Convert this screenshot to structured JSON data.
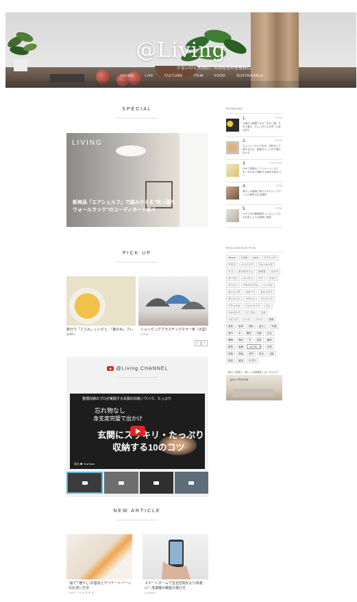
{
  "site": {
    "logo": "@Living",
    "tagline": "少ないけど大切に、大切なものを毎日に。",
    "nav": [
      "LIVING",
      "LIFE",
      "CULTURE",
      "ITEM",
      "FOOD",
      "SUSTAINABLE"
    ]
  },
  "special": {
    "heading": "SPECIAL",
    "feature": {
      "label": "LIVING",
      "caption": "新商品「エアシェルフ」で組みかえる“突っ張りウォールラック”のコーディネート術６"
    }
  },
  "pickup": {
    "heading": "PICK UP",
    "cards": [
      {
        "text": "数分で「ささみ」レシピと、「春の水」ブレンド",
        "tag": "FOOD"
      },
      {
        "text": "ショッピングプラスチックカラー傘（大型）",
        "tag": "ITEM"
      }
    ],
    "prev": "‹",
    "next": "›"
  },
  "channel": {
    "heading": "@Living CHANNEL",
    "video": {
      "title": "整理収納のプロが実践する玄関の収納ノウハウ、たっぷり",
      "line1": "忘れ物なし",
      "line2": "身支度完璧で出かけ",
      "big1": "玄関にスッキリ・たっぷり",
      "big2": "収納する10のコツ",
      "watch": "見る ▶ YouTube"
    }
  },
  "new_article": {
    "heading": "NEW ARTICLE",
    "cards": [
      {
        "text": "“捨て”“増やし”の基本とデリケートゾーンのお洗い方法",
        "tag": "LIFE・ヘルスケア"
      },
      {
        "text": "スマートホームで生活空間がより快適に！洗濯機の機能の選び方",
        "tag": "LIVING"
      }
    ]
  },
  "sidebar": {
    "ranking_heading": "RANKING",
    "ranking": [
      {
        "num": "1.",
        "cat": "FOOD",
        "text": "冷凍から調理できる「まぜご飯」を作り置き、忙しい日でも手早くお弁当作り"
      },
      {
        "num": "2.",
        "cat": "FOOD",
        "text": "ホムフォーカルで作る！材料なしで漬けるだけ、簡単おいしい作り置きおかず"
      },
      {
        "num": "3.",
        "cat": "CULTURE",
        "text": "SNSで話題の「パッケージ」の工夫！iPhoneで撮影する猫の写真のコツ"
      },
      {
        "num": "4.",
        "cat": "ITEM",
        "text": "暮らしの道具に取り入れたい！ナチュラル素材の生活雑貨"
      },
      {
        "num": "5.",
        "cat": "ITEM",
        "text": "やすらぎの朝時間をつくるシンプルなお気に入りの家具と雑貨"
      }
    ],
    "tags_heading": "Recommend TAG",
    "tags": [
      "iPhone",
      "100均",
      "IKEA",
      "アウトドア",
      "アロマ",
      "インテリア",
      "ウォーキング",
      "エコ",
      "おうちカフェ",
      "お弁当",
      "カメラ",
      "ガーデン",
      "キッチン",
      "ケア",
      "コスメ",
      "コーヒー",
      "サステナブル",
      "シンプル",
      "ストレッチ",
      "スポーツ",
      "セルフケア",
      "ダイエット",
      "デザイン",
      "テレワーク",
      "ナチュラル",
      "ハンドメイド",
      "パン",
      "ヘルスケア",
      "ミニマル",
      "ヨガ",
      "リビング",
      "レシピ",
      "ワイン",
      "収納",
      "家具",
      "家事",
      "掃除",
      "暮らし",
      "料理",
      "旅行",
      "本",
      "植物",
      "洗濯",
      "生活",
      "睡眠",
      "節約",
      "花",
      "読書",
      "趣味",
      "雑貨",
      "食器",
      "器",
      "手帳",
      "文具",
      "音楽",
      "映画",
      "育児",
      "防災",
      "北欧",
      "和室",
      "朝活",
      "片付け"
    ],
    "more": "MORE",
    "banner_label": "暮らし快適に、新しいお部屋探しはこちらから",
    "banner_logo": "goo ROOM"
  }
}
